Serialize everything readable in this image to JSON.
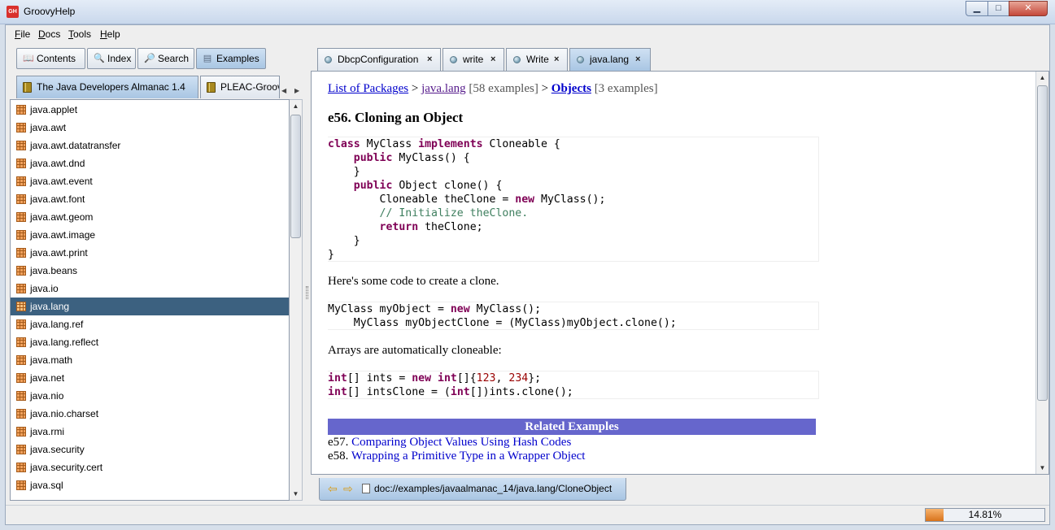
{
  "window": {
    "title": "GroovyHelp",
    "app_icon": "GH",
    "minimize": "▁",
    "maximize": "□",
    "close": "✕"
  },
  "menu": [
    "File",
    "Docs",
    "Tools",
    "Help"
  ],
  "nav_buttons": [
    {
      "label": "Contents",
      "icon": "book-open-icon",
      "glyph": "📖"
    },
    {
      "label": "Index",
      "icon": "magnifier-icon",
      "glyph": "🔍"
    },
    {
      "label": "Search",
      "icon": "find-icon",
      "glyph": "🔎"
    },
    {
      "label": "Examples",
      "icon": "examples-icon",
      "glyph": "▤"
    }
  ],
  "book_tabs": [
    "The Java Developers Almanac 1.4",
    "PLEAC-Groovy"
  ],
  "packages": [
    "java.applet",
    "java.awt",
    "java.awt.datatransfer",
    "java.awt.dnd",
    "java.awt.event",
    "java.awt.font",
    "java.awt.geom",
    "java.awt.image",
    "java.awt.print",
    "java.beans",
    "java.io",
    "java.lang",
    "java.lang.ref",
    "java.lang.reflect",
    "java.math",
    "java.net",
    "java.nio",
    "java.nio.charset",
    "java.rmi",
    "java.security",
    "java.security.cert",
    "java.sql"
  ],
  "selected_package": "java.lang",
  "doc_tabs": [
    {
      "label": "DbcpConfiguration",
      "close": "×"
    },
    {
      "label": "write",
      "close": "×"
    },
    {
      "label": "Write",
      "close": "×"
    },
    {
      "label": "java.lang",
      "close": "×"
    }
  ],
  "content": {
    "breadcrumb": {
      "root": "List of Packages",
      "sep": " > ",
      "pkg": "java.lang",
      "pkg_count": "[58 examples]",
      "cat": "Objects",
      "cat_count": "[3 examples]"
    },
    "heading": "e56. Cloning an Object",
    "para1": "Here's some code to create a clone.",
    "para2": "Arrays are automatically cloneable:",
    "related_header": "Related Examples",
    "related": [
      {
        "id": "e57.",
        "title": "Comparing Object Values Using Hash Codes"
      },
      {
        "id": "e58.",
        "title": "Wrapping a Primitive Type in a Wrapper Object"
      }
    ]
  },
  "address": "doc://examples/javaalmanac_14/java.lang/CloneObject",
  "status": {
    "progress": 0.1481,
    "progress_label": "14.81%"
  },
  "colors": {
    "selection": "#3c6180",
    "related_bar": "#6666cc",
    "keyword": "#7f0055",
    "comment": "#3f7f5f",
    "link": "#0000cc"
  }
}
